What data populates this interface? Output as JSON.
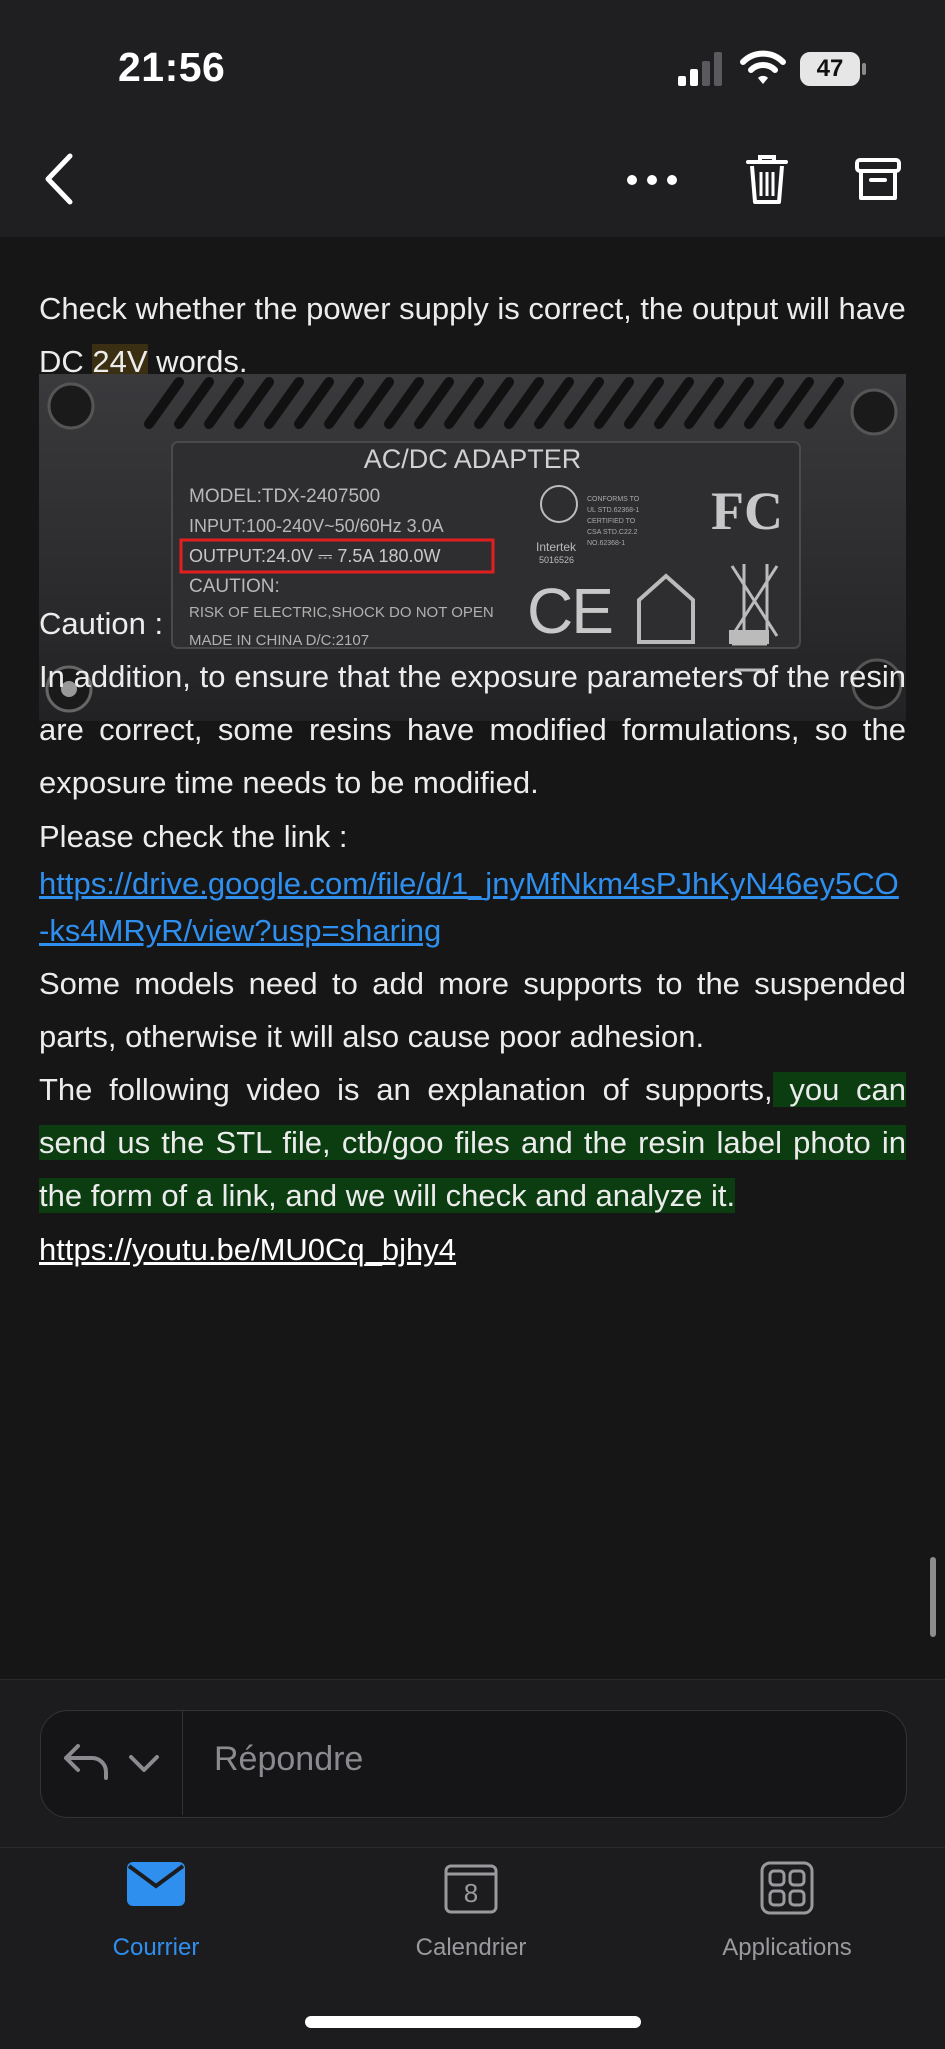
{
  "status": {
    "time": "21:56",
    "battery": "47"
  },
  "content": {
    "intro_prefix": "Check whether the power supply is correct, the output will have DC ",
    "intro_highlight": "24V",
    "intro_suffix": " words.",
    "photo": {
      "title": "AC/DC ADAPTER",
      "model": "MODEL:TDX-2407500",
      "input": "INPUT:100-240V~50/60Hz  3.0A",
      "output": "OUTPUT:24.0V ⎓ 7.5A 180.0W",
      "caution": "CAUTION:",
      "risk": "RISK OF ELECTRIC,SHOCK DO NOT OPEN",
      "made": "MADE IN CHINA    D/C:2107",
      "cert_lines": [
        "CONFORMS TO",
        "UL STD.62368-1",
        "CERTIFIED TO",
        "CSA STD.C22.2",
        "NO.62368-1"
      ],
      "intertek": "Intertek",
      "intertek_no": "5016526",
      "fcc": "FC",
      "ce": "CE"
    },
    "caution_title": "Caution :",
    "caution_body": "In addition, to ensure that the exposure parameters of the resin are correct, some resins have modified formulations, so the exposure time needs to be modified.",
    "check_link_label": "Please check the link :",
    "drive_link": "https://drive.google.com/file/d/1_jnyMfNkm4sPJhKyN46ey5CO-ks4MRyR/view?usp=sharing",
    "supports_body": "Some models need to add more supports to the suspended parts, otherwise it will also cause poor adhesion.",
    "video_prefix": "The following video is an explanation of supports,",
    "video_highlight": " you can send us the STL file, ctb/goo files and the resin label photo in the form of a link, and we will check and analyze it.",
    "youtube_link": "https://youtu.be/MU0Cq_bjhy4"
  },
  "reply": {
    "placeholder": "Répondre"
  },
  "tabs": [
    {
      "label": "Courrier",
      "color": "#2f8fef"
    },
    {
      "label": "Calendrier",
      "day": "8",
      "color": "#9a9a9e"
    },
    {
      "label": "Applications",
      "color": "#9a9a9e"
    }
  ]
}
